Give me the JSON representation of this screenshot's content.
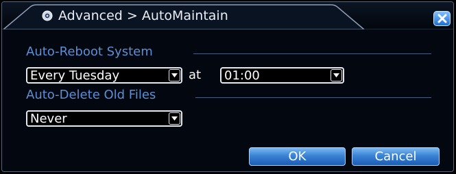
{
  "window": {
    "title": "Advanced > AutoMaintain",
    "title_icon": "gear-icon",
    "close_icon": "close-icon"
  },
  "auto_reboot": {
    "section_label": "Auto-Reboot System",
    "day_value": "Every Tuesday",
    "at_label": "at",
    "time_value": "01:00"
  },
  "auto_delete": {
    "section_label": "Auto-Delete Old Files",
    "value": "Never"
  },
  "buttons": {
    "ok_label": "OK",
    "cancel_label": "Cancel"
  },
  "colors": {
    "accent_blue": "#3a83d4",
    "section_text": "#5d8fd6",
    "background": "#03070f"
  }
}
